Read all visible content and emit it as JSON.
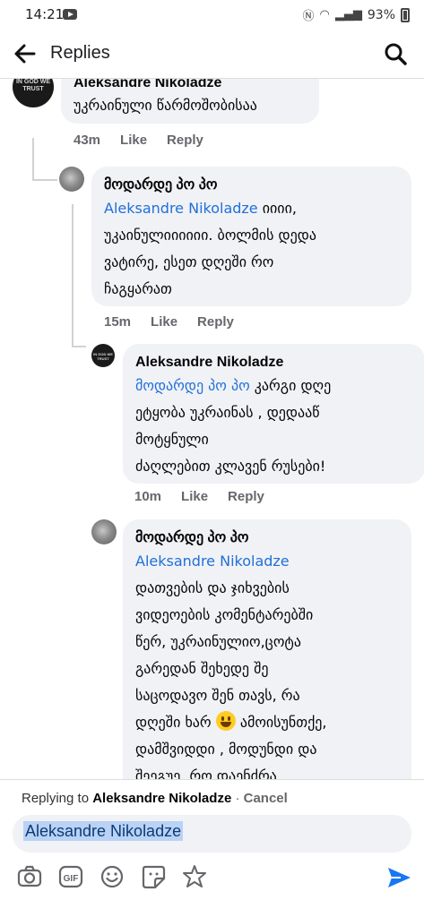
{
  "status_bar": {
    "time": "14:21",
    "battery": "93%"
  },
  "header": {
    "title": "Replies"
  },
  "comments": [
    {
      "author": "Aleksandre Nikoladze",
      "avatar_text": "IN GOD WE TRUST",
      "text": "უკრაინული წარმოშობისაა",
      "time": "43m",
      "like": "Like",
      "reply": "Reply"
    },
    {
      "author": "მოდარდე პო პო",
      "mention": "Aleksandre Nikoladze",
      "text_line1": " იიიი,",
      "text_rest": [
        "უკაინულიიიიიი. ბოლმის დედა",
        "ვატირე, ესეთ დღეში რო",
        "ჩაგყარათ"
      ],
      "time": "15m",
      "like": "Like",
      "reply": "Reply"
    },
    {
      "author": "Aleksandre Nikoladze",
      "avatar_text": "IN GOD WE TRUST",
      "mention": "მოდარდე პო პო",
      "text_line1": " კარგი დღე",
      "text_rest": [
        "ეტყობა უკრაინას , დედააწ",
        "მოტყნული",
        "ძაღლებით კლავენ რუსები!"
      ],
      "time": "10m",
      "like": "Like",
      "reply": "Reply"
    },
    {
      "author": "მოდარდე პო პო",
      "mention": "Aleksandre Nikoladze",
      "text_lines": [
        "დათვების და ჯიხვების",
        "ვიდეოების კომენტარებში",
        "წერ, უკრაინულიო,ცოტა",
        "გარედან შეხედე შე",
        "საცოდავო შენ თავს, რა"
      ],
      "line_emoji_before": "დღეში ხარ ",
      "line_emoji_after": " ამოისუნთქე,",
      "text_tail": [
        "დამშვიდდი , მოდუნდი და",
        "შეეგუე, რო დაენძრა"
      ]
    }
  ],
  "composer": {
    "replying_prefix": "Replying to ",
    "replying_to": "Aleksandre Nikoladze",
    "separator": " · ",
    "cancel": "Cancel",
    "input_value": "Aleksandre Nikoladze"
  },
  "toolbar": {
    "icons": [
      "camera-icon",
      "gif-icon",
      "emoji-icon",
      "sticker-icon",
      "avatar-sticker-icon"
    ],
    "gif_label": "GIF",
    "send_color": "#1877f2"
  }
}
